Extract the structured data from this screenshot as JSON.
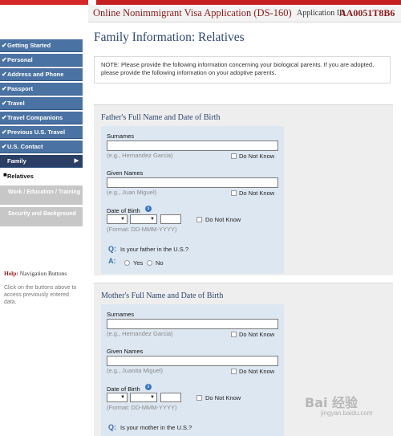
{
  "header": {
    "app_title": "Online Nonimmigrant Visa Application (DS-160)",
    "app_id_label": "Application ID",
    "app_id": "AA0051T8B6"
  },
  "sidebar": {
    "items": [
      {
        "label": "Getting Started"
      },
      {
        "label": "Personal"
      },
      {
        "label": "Address and Phone"
      },
      {
        "label": "Passport"
      },
      {
        "label": "Travel"
      },
      {
        "label": "Travel Companions"
      },
      {
        "label": "Previous U.S. Travel"
      },
      {
        "label": "U.S. Contact"
      }
    ],
    "active": {
      "label": "Family"
    },
    "sub_item": {
      "label": "Relatives"
    },
    "disabled": [
      {
        "label": "Work / Education / Training"
      },
      {
        "label": "Security and Background"
      }
    ]
  },
  "help": {
    "prefix": "Help:",
    "title": "Navigation Buttons",
    "text": "Click on the buttons above to access previously entered data."
  },
  "main": {
    "page_title": "Family Information: Relatives",
    "note": "NOTE: Please provide the following information concerning your biological parents. If you are adopted, please provide the following information on your adoptive parents."
  },
  "father": {
    "section_title": "Father's Full Name and Date of Birth",
    "surnames_label": "Surnames",
    "surnames_value": "",
    "surnames_hint": "(e.g., Hernandez Garcia)",
    "given_label": "Given Names",
    "given_value": "",
    "given_hint": "(e.g., Juan Miguel)",
    "dob_label": "Date of Birth",
    "dob_hint": "(Format: DD-MMM-YYYY)",
    "do_not_know": "Do Not Know",
    "q_marker": "Q:",
    "question": "Is your father in the U.S.?",
    "a_marker": "A:",
    "yes": "Yes",
    "no": "No"
  },
  "mother": {
    "section_title": "Mother's Full Name and Date of Birth",
    "surnames_label": "Surnames",
    "surnames_value": "",
    "surnames_hint": "(e.g., Hernandez Garcia)",
    "given_label": "Given Names",
    "given_value": "",
    "given_hint": "(e.g., Juanita Miguel)",
    "dob_label": "Date of Birth",
    "dob_hint": "(Format: DD-MMM-YYYY)",
    "do_not_know": "Do Not Know",
    "q_marker": "Q:",
    "question": "Is your mother in the U.S.?"
  },
  "icons": {
    "check": "✔",
    "arrow": "▶",
    "info": "i",
    "select_arrow": "▼",
    "bullet": "■"
  },
  "watermark": {
    "text": "Bai 经验",
    "sub": "jingyan.baidu.com"
  },
  "colors": {
    "nav_bg": "#4a72a3",
    "nav_active_bg": "#2b3f66",
    "title_red": "#8b1a1a",
    "section_title_blue": "#2e4670",
    "panel_bg": "#dde7f1"
  }
}
